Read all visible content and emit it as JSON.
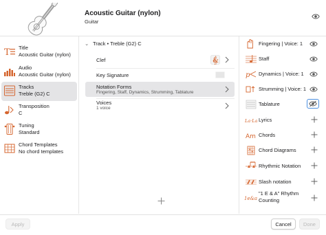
{
  "header": {
    "title": "Acoustic Guitar (nylon)",
    "subtitle": "Guitar"
  },
  "sidebar": {
    "items": [
      {
        "title": "Title",
        "value": "Acoustic Guitar (nylon)",
        "icon": "title-icon"
      },
      {
        "title": "Audio",
        "value": "Acoustic Guitar (nylon)",
        "icon": "audio-meter-icon"
      },
      {
        "title": "Tracks",
        "value": "Treble (G2) C",
        "icon": "tracks-icon",
        "active": true
      },
      {
        "title": "Transposition",
        "value": "C",
        "icon": "transposition-icon"
      },
      {
        "title": "Tuning",
        "value": "Standard",
        "icon": "tuning-icon"
      },
      {
        "title": "Chord Templates",
        "value": "No chord templates",
        "icon": "chord-grid-icon"
      }
    ]
  },
  "middle": {
    "track_header": "Track • Treble (G2) C",
    "rows": {
      "clef": "Clef",
      "key_signature": "Key Signature",
      "notation_forms": "Notation Forms",
      "notation_forms_sub": "Fingering, Staff, Dynamics, Strumming, Tablature",
      "voices": "Voices",
      "voices_sub": "1 voice"
    }
  },
  "right": {
    "items": [
      {
        "label": "Fingering | Voice: 1",
        "icon": "fingering-icon",
        "action": "eye"
      },
      {
        "label": "Staff",
        "icon": "staff-icon",
        "action": "eye"
      },
      {
        "label": "Dynamics | Voice: 1",
        "icon": "dynamics-icon",
        "action": "eye"
      },
      {
        "label": "Strumming | Voice: 1",
        "icon": "strumming-icon",
        "action": "eye"
      },
      {
        "label": "Tablature",
        "icon": "tablature-icon",
        "action": "eye-selected"
      },
      {
        "label": "Lyrics",
        "icon": "lyrics-icon",
        "icon_text": "La·La",
        "action": "add"
      },
      {
        "label": "Chords",
        "icon": "chords-icon",
        "icon_text": "Am",
        "action": "add"
      },
      {
        "label": "Chord Diagrams",
        "icon": "chord-diagram-icon",
        "action": "add"
      },
      {
        "label": "Rhythmic Notation",
        "icon": "rhythmic-notation-icon",
        "action": "add"
      },
      {
        "label": "Slash notation",
        "icon": "slash-notation-icon",
        "action": "add"
      },
      {
        "label_line1": "\"1 E & A\" Rhythm",
        "label_line2": "Counting",
        "icon": "rhythm-counting-icon",
        "icon_text": "1e&a",
        "action": "add"
      }
    ]
  },
  "footer": {
    "apply": "Apply",
    "cancel": "Cancel",
    "done": "Done"
  },
  "colors": {
    "accent_orange": "#d5652e",
    "selection_gray": "#e4e4e6",
    "focus_blue": "#4a8fe0"
  }
}
